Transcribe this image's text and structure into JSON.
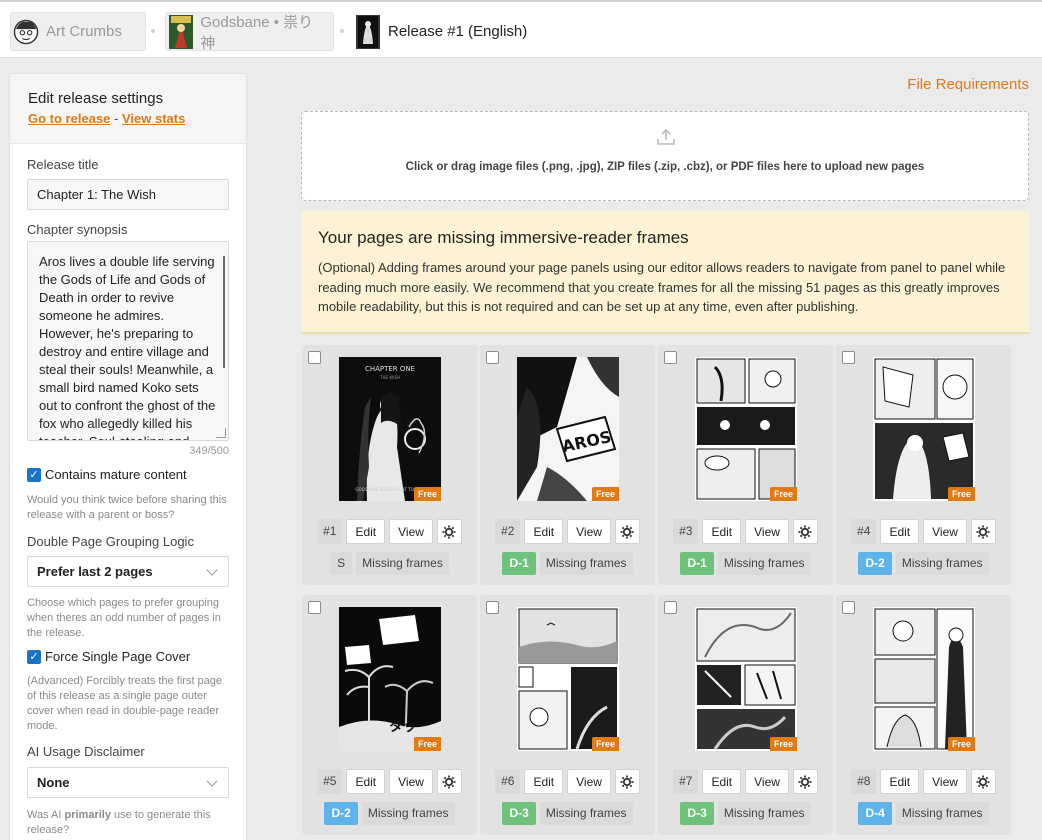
{
  "breadcrumbs": [
    {
      "label": "Art Crumbs"
    },
    {
      "label": "Godsbane • 祟り神"
    },
    {
      "label": "Release #1 (English)"
    }
  ],
  "sidebar": {
    "heading": "Edit release settings",
    "go_link": "Go to release",
    "link_sep": "-",
    "stats_link": "View stats",
    "title_label": "Release title",
    "title_value": "Chapter 1: The Wish",
    "synopsis_label": "Chapter synopsis",
    "synopsis_value": "Aros lives a double life serving the Gods of Life and Gods of Death in order to revive someone he admires. However, he's preparing to destroy and entire village and steal their souls! Meanwhile, a small bird named Koko sets out to confront the ghost of the fox who allegedly killed his teacher. Soul-stealing and",
    "synopsis_count": "349/500",
    "mature_label": "Contains mature content",
    "mature_help": "Would you think twice before sharing this release with a parent or boss?",
    "grouping_label": "Double Page Grouping Logic",
    "grouping_value": "Prefer last 2 pages",
    "grouping_help": "Choose which pages to prefer grouping when theres an odd number of pages in the release.",
    "cover_label": "Force Single Page Cover",
    "cover_help": "(Advanced) Forcibly treats the first page of this release as a single page outer cover when read in double-page reader mode.",
    "ai_label": "AI Usage Disclaimer",
    "ai_value": "None",
    "ai_help_a": "Was AI ",
    "ai_help_b": "primarily",
    "ai_help_c": " use to generate this release?"
  },
  "main": {
    "file_requirements": "File Requirements",
    "dropzone_text": "Click or drag image files (.png, .jpg), ZIP files (.zip, .cbz), or PDF files here to upload new pages",
    "notice_title": "Your pages are missing immersive-reader frames",
    "notice_body": "(Optional) Adding frames around your page panels using our editor allows readers to navigate from panel to panel while reading much more easily. We recommend that you create frames for all the missing 51 pages as this greatly improves mobile readability, but this is not required and can be set up at any time, even after publishing."
  },
  "labels": {
    "edit": "Edit",
    "view": "View",
    "missing": "Missing frames",
    "free": "Free"
  },
  "pages": [
    {
      "num": "#1",
      "tag": "S",
      "tag_color": "grey"
    },
    {
      "num": "#2",
      "tag": "D-1",
      "tag_color": "green"
    },
    {
      "num": "#3",
      "tag": "D-1",
      "tag_color": "green"
    },
    {
      "num": "#4",
      "tag": "D-2",
      "tag_color": "blue"
    },
    {
      "num": "#5",
      "tag": "D-2",
      "tag_color": "blue"
    },
    {
      "num": "#6",
      "tag": "D-3",
      "tag_color": "green"
    },
    {
      "num": "#7",
      "tag": "D-3",
      "tag_color": "green"
    },
    {
      "num": "#8",
      "tag": "D-4",
      "tag_color": "blue"
    }
  ],
  "colors": {
    "accent": "#e07a12",
    "green_tag": "#6ec27b",
    "blue_tag": "#5db3ea",
    "checkbox": "#1a73c9"
  }
}
